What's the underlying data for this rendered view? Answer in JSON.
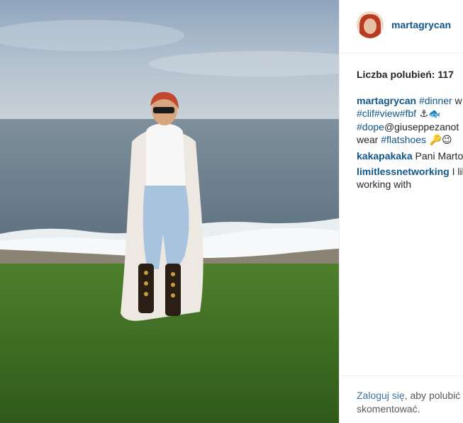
{
  "post": {
    "photo_alt": "photo",
    "author": "martagrycan"
  },
  "stats": {
    "likes": "Liczba polubień: 117"
  },
  "caption": {
    "user": "martagrycan",
    "line1_tag": "#dinner",
    "line1_text": " w",
    "line2_tags": "#clif#view#fbf",
    "line2_emoji": " ⚓🐟",
    "line3_tag": "#dope",
    "line3_text": "@giuseppezanot",
    "line4_text": "wear ",
    "line4_tag": "#flatshoes",
    "line4_emoji": " 🔑😉"
  },
  "comments": [
    {
      "user": "kakapakaka",
      "text": " Pani Marto"
    },
    {
      "user": "limitlessnetworking",
      "text": " I lik",
      "text2": "working with"
    }
  ],
  "footer": {
    "login_label": "Zaloguj się",
    "rest": ", aby polubić",
    "rest2": "skomentować."
  },
  "colors": {
    "link": "#125688",
    "sky": "#a9b8c8",
    "sea": "#6f8190",
    "grass": "#3f6e22"
  }
}
